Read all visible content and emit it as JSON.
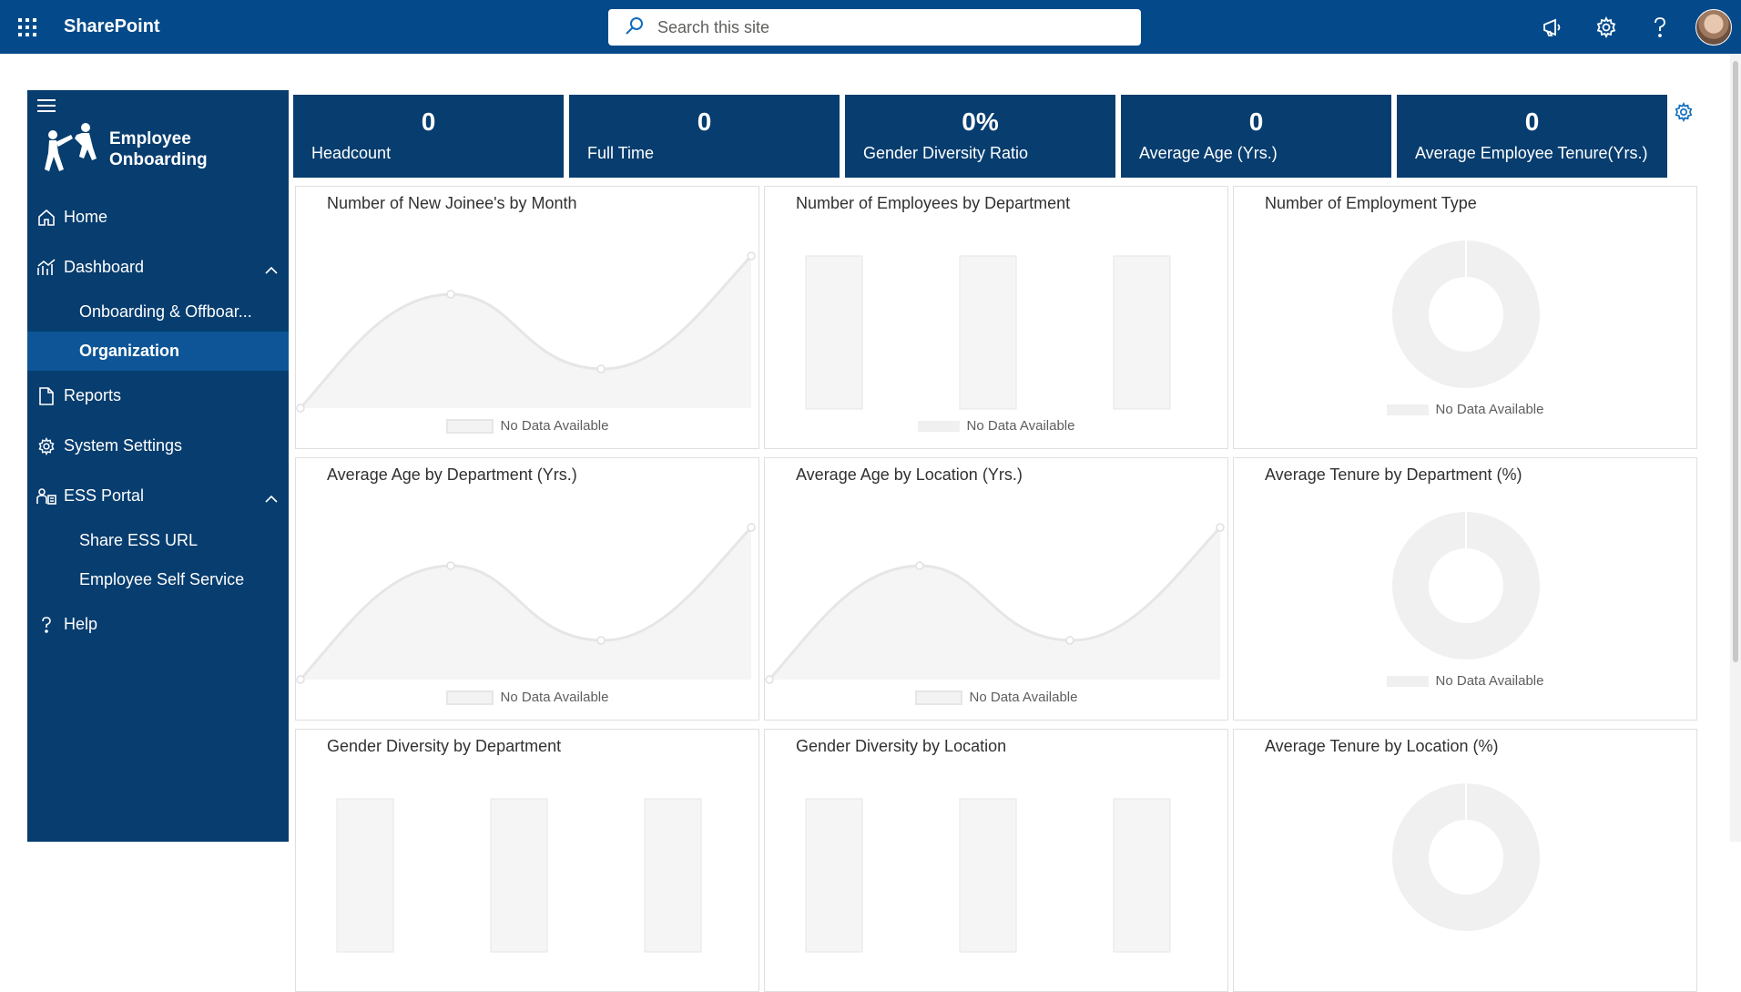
{
  "suite": {
    "brand": "SharePoint",
    "search_placeholder": "Search this site",
    "icons": [
      "app-launcher-icon",
      "megaphone-icon",
      "gear-icon",
      "help-icon",
      "avatar"
    ]
  },
  "sidebar": {
    "logo_line1": "Employee",
    "logo_line2": "Onboarding",
    "items": [
      {
        "label": "Home",
        "icon": "home-icon"
      },
      {
        "label": "Dashboard",
        "icon": "chart-icon"
      },
      {
        "label": "Onboarding & Offboar..."
      },
      {
        "label": "Organization"
      },
      {
        "label": "Reports",
        "icon": "document-icon"
      },
      {
        "label": "System Settings",
        "icon": "gear-icon"
      },
      {
        "label": "ESS Portal",
        "icon": "people-icon"
      },
      {
        "label": "Share ESS URL"
      },
      {
        "label": "Employee Self Service"
      },
      {
        "label": "Help",
        "icon": "question-icon"
      }
    ]
  },
  "kpis": [
    {
      "value": "0",
      "label": "Headcount"
    },
    {
      "value": "0",
      "label": "Full Time"
    },
    {
      "value": "0%",
      "label": "Gender Diversity Ratio"
    },
    {
      "value": "0",
      "label": "Average Age (Yrs.)"
    },
    {
      "value": "0",
      "label": "Average Employee Tenure(Yrs.)"
    }
  ],
  "cards": [
    {
      "title": "Number of New Joinee's by Month",
      "type": "area",
      "legend": "No Data Available"
    },
    {
      "title": "Number of Employees by Department",
      "type": "bar",
      "legend": "No Data Available"
    },
    {
      "title": "Number of Employment Type",
      "type": "donut",
      "legend": "No Data Available"
    },
    {
      "title": "Average Age by Department (Yrs.)",
      "type": "area",
      "legend": "No Data Available"
    },
    {
      "title": "Average Age by Location (Yrs.)",
      "type": "area",
      "legend": "No Data Available"
    },
    {
      "title": "Average Tenure by Department (%)",
      "type": "donut",
      "legend": "No Data Available"
    },
    {
      "title": "Gender Diversity by Department",
      "type": "bar",
      "legend": ""
    },
    {
      "title": "Gender Diversity by Location",
      "type": "bar",
      "legend": ""
    },
    {
      "title": "Average Tenure by Location (%)",
      "type": "donut",
      "legend": ""
    }
  ],
  "colors": {
    "primary": "#073d6f",
    "suitebar": "#044a8a",
    "active_nav": "#0d5596",
    "placeholder_gray": "#e6e6e6"
  }
}
